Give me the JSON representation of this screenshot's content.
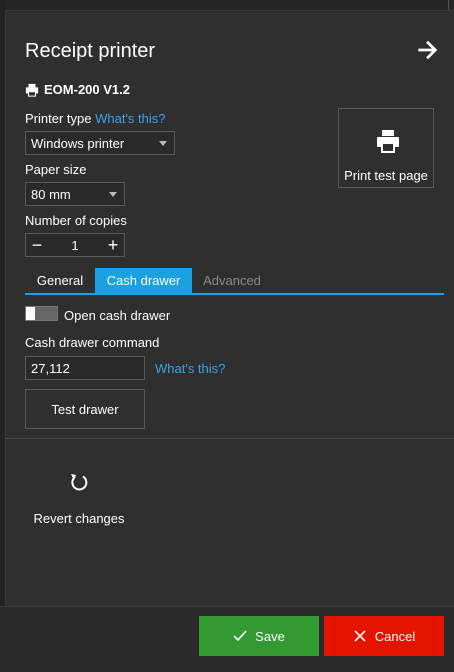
{
  "dialog": {
    "title": "Receipt printer",
    "device_name": "EOM-200 V1.2"
  },
  "printer_type": {
    "label": "Printer type",
    "help_link": "What's this?",
    "value": "Windows printer"
  },
  "paper_size": {
    "label": "Paper size",
    "value": "80 mm"
  },
  "copies": {
    "label": "Number of copies",
    "value": "1",
    "minus": "−",
    "plus": "+"
  },
  "print_test": {
    "label": "Print test page"
  },
  "tabs": [
    {
      "label": "General",
      "active": false
    },
    {
      "label": "Cash drawer",
      "active": true
    },
    {
      "label": "Advanced",
      "active": false
    }
  ],
  "cash_drawer": {
    "toggle_label": "Open cash drawer",
    "toggle_on": false,
    "command_label": "Cash drawer command",
    "command_value": "27,112",
    "help_link": "What's this?",
    "test_button": "Test drawer"
  },
  "revert": {
    "label": "Revert changes"
  },
  "footer": {
    "save_label": "Save",
    "cancel_label": "Cancel"
  },
  "colors": {
    "accent": "#1ba1e2",
    "link": "#3aa5e8",
    "save": "#339933",
    "cancel": "#e51400",
    "background": "#2f2f2f"
  },
  "icons": {
    "back": "arrow-right-icon",
    "device": "printer-icon",
    "print_test": "printer-icon",
    "revert": "undo-icon",
    "save": "checkmark-icon",
    "cancel": "close-icon"
  }
}
